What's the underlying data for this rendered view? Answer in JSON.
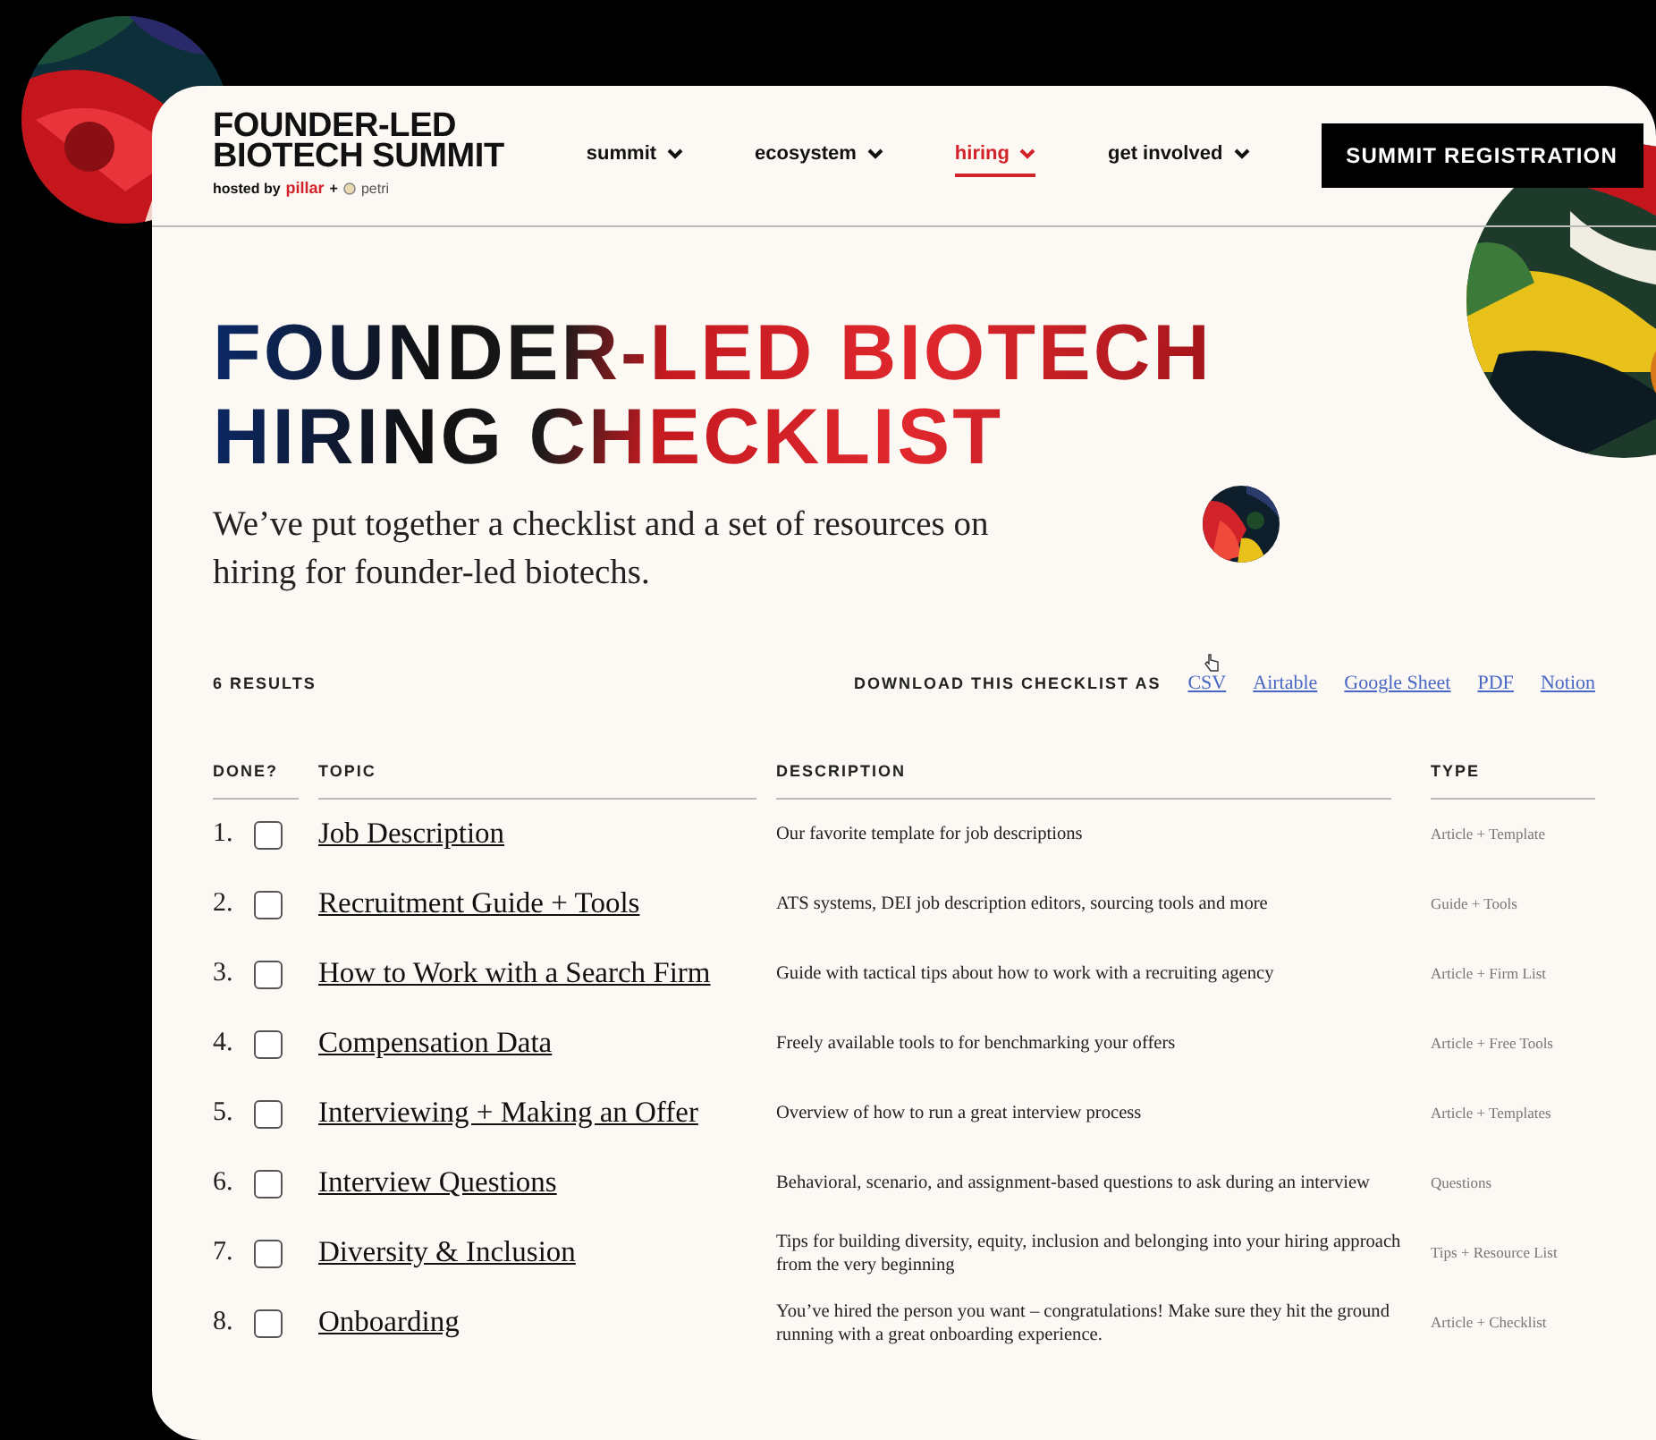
{
  "logo": {
    "line_1": "FOUNDER-LED",
    "line_2": "BIOTECH SUMMIT",
    "hosted_by": "hosted by",
    "partner_1": "pillar",
    "plus": "+",
    "partner_2": "petri"
  },
  "nav": [
    {
      "label": "summit",
      "selected": false
    },
    {
      "label": "ecosystem",
      "selected": false
    },
    {
      "label": "hiring",
      "selected": true
    },
    {
      "label": "get involved",
      "selected": false
    }
  ],
  "cta": "SUMMIT REGISTRATION",
  "hero": {
    "title_line_1": "FOUNDER-LED BIOTECH",
    "title_line_2": "HIRING CHECKLIST",
    "subtitle": "We’ve put together a checklist and a set of resources on hiring for founder-led biotechs."
  },
  "results_count": "6 RESULTS",
  "download": {
    "label": "DOWNLOAD THIS CHECKLIST AS",
    "links": [
      "CSV",
      "Airtable",
      "Google Sheet",
      "PDF",
      "Notion"
    ]
  },
  "table": {
    "columns": [
      "DONE?",
      "TOPIC",
      "DESCRIPTION",
      "TYPE"
    ],
    "rows": [
      {
        "number": "1.",
        "checked": false,
        "topic": "Job Description",
        "description": "Our favorite template for job descriptions",
        "type": "Article + Template"
      },
      {
        "number": "2.",
        "checked": false,
        "topic": "Recruitment Guide + Tools",
        "description": "ATS systems, DEI job description editors, sourcing tools and more",
        "type": "Guide + Tools"
      },
      {
        "number": "3.",
        "checked": false,
        "topic": "How to Work with a Search Firm",
        "description": "Guide with tactical tips about how to work with a recruiting agency",
        "type": "Article + Firm List"
      },
      {
        "number": "4.",
        "checked": false,
        "topic": "Compensation Data",
        "description": "Freely available tools to for benchmarking your offers",
        "type": "Article + Free Tools"
      },
      {
        "number": "5.",
        "checked": false,
        "topic": "Interviewing + Making an Offer",
        "description": "Overview of how to run a great interview process",
        "type": "Article + Templates"
      },
      {
        "number": "6.",
        "checked": false,
        "topic": "Interview Questions",
        "description": "Behavioral, scenario, and assignment-based questions to ask during an interview",
        "type": "Questions"
      },
      {
        "number": "7.",
        "checked": false,
        "topic": "Diversity & Inclusion",
        "description": "Tips for building diversity, equity, inclusion and belonging into your hiring approach from the very beginning",
        "type": "Tips + Resource List"
      },
      {
        "number": "8.",
        "checked": false,
        "topic": "Onboarding",
        "description": "You’ve hired the person you want – congratulations! Make sure they hit the ground running with a great onboarding experience.",
        "type": "Article + Checklist"
      }
    ]
  }
}
